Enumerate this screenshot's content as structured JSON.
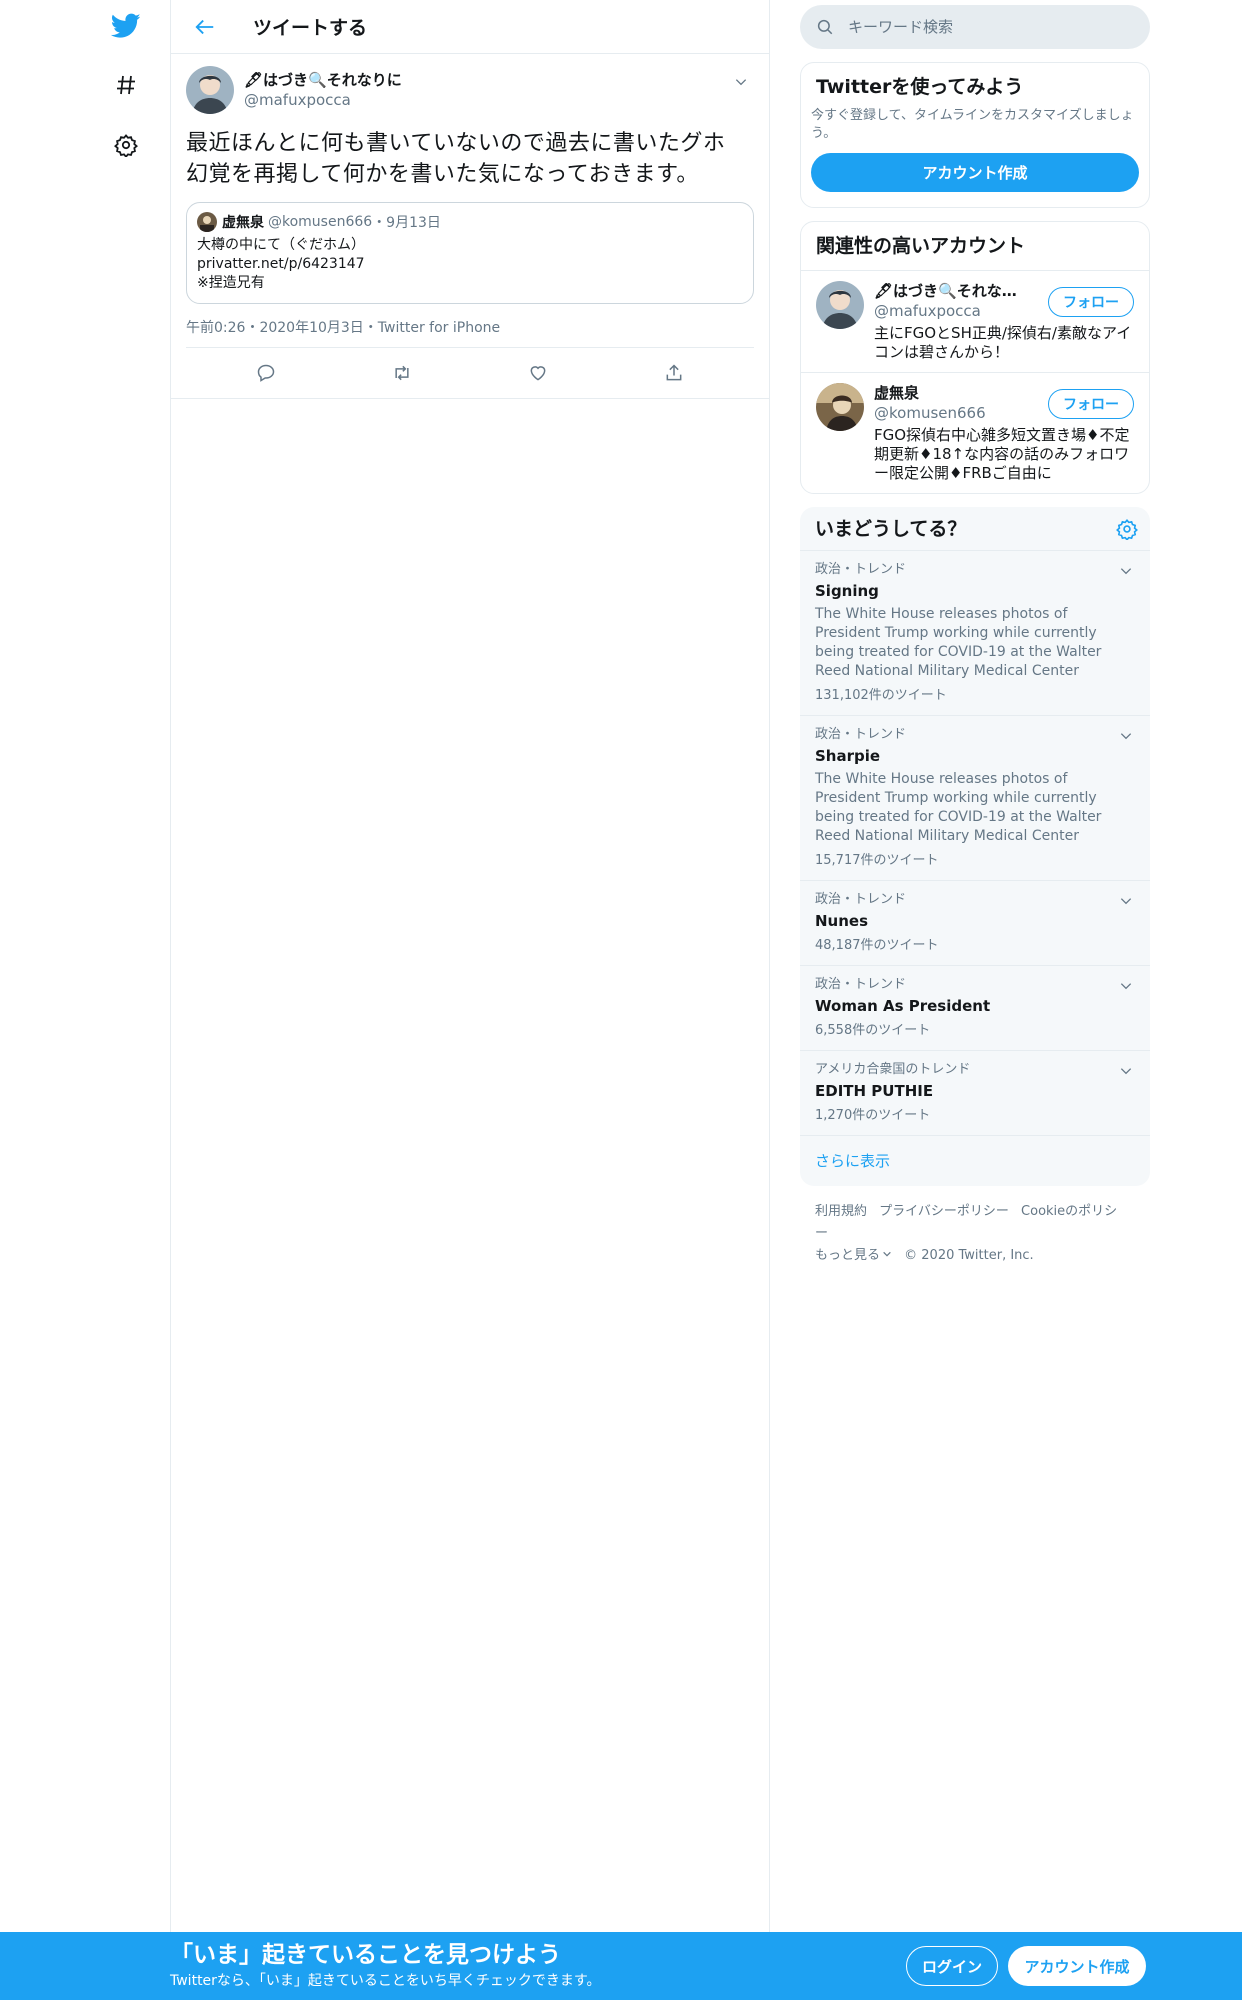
{
  "colors": {
    "accent": "#1da1f2",
    "secondary_text": "#657786",
    "border": "#e6ecf0"
  },
  "nav": {
    "items": [
      {
        "icon": "twitter-bird-icon"
      },
      {
        "icon": "hashtag-icon"
      },
      {
        "icon": "gear-icon"
      }
    ]
  },
  "header": {
    "title": "ツイートする"
  },
  "tweet": {
    "display_name": "🖋はづき🔍それなりに",
    "handle": "@mafuxpocca",
    "text": "最近ほんとに何も書いていないので過去に書いたグホ幻覚を再掲して何かを書いた気になっておきます。",
    "quote": {
      "display_name": "虚無泉",
      "handle": "@komusen666",
      "date": "・9月13日",
      "lines": [
        "大樽の中にて（ぐだホム）",
        "privatter.net/p/6423147",
        "※捏造兄有"
      ]
    },
    "timestamp": "午前0:26・2020年10月3日・Twitter for iPhone",
    "actions": [
      "reply-icon",
      "retweet-icon",
      "like-icon",
      "share-icon"
    ]
  },
  "search": {
    "placeholder": "キーワード検索"
  },
  "signup_card": {
    "title": "Twitterを使ってみよう",
    "desc": "今すぐ登録して、タイムラインをカスタマイズしましょう。",
    "button": "アカウント作成"
  },
  "related": {
    "title": "関連性の高いアカウント",
    "items": [
      {
        "name": "🖋はづき🔍それなりに",
        "handle": "@mafuxpocca",
        "bio": "主にFGOとSH正典/探偵右/素敵なアイコンは碧さんから！",
        "follow": "フォロー"
      },
      {
        "name": "虚無泉",
        "handle": "@komusen666",
        "bio": "FGO探偵右中心雑多短文置き場♦不定期更新♦18↑な内容の話のみフォロワー限定公開♦FRBご自由に",
        "follow": "フォロー"
      }
    ]
  },
  "trends": {
    "title": "いまどうしてる？",
    "items": [
      {
        "meta": "政治・トレンド",
        "name": "Signing",
        "desc": "The White House releases photos of President Trump working while currently being treated for COVID-19 at the Walter Reed National Military Medical Center",
        "count": "131,102件のツイート"
      },
      {
        "meta": "政治・トレンド",
        "name": "Sharpie",
        "desc": "The White House releases photos of President Trump working while currently being treated for COVID-19 at the Walter Reed National Military Medical Center",
        "count": "15,717件のツイート"
      },
      {
        "meta": "政治・トレンド",
        "name": "Nunes",
        "desc": "",
        "count": "48,187件のツイート"
      },
      {
        "meta": "政治・トレンド",
        "name": "Woman As President",
        "desc": "",
        "count": "6,558件のツイート"
      },
      {
        "meta": "アメリカ合衆国のトレンド",
        "name": "EDITH PUTHIE",
        "desc": "",
        "count": "1,270件のツイート"
      }
    ],
    "show_more": "さらに表示"
  },
  "footer": {
    "links": [
      "利用規約",
      "プライバシーポリシー",
      "Cookieのポリシー"
    ],
    "more": "もっと見る",
    "copyright": "© 2020 Twitter, Inc."
  },
  "bottom_bar": {
    "title": "「いま」起きていることを見つけよう",
    "sub": "Twitterなら、「いま」起きていることをいち早くチェックできます。",
    "login": "ログイン",
    "signup": "アカウント作成"
  }
}
